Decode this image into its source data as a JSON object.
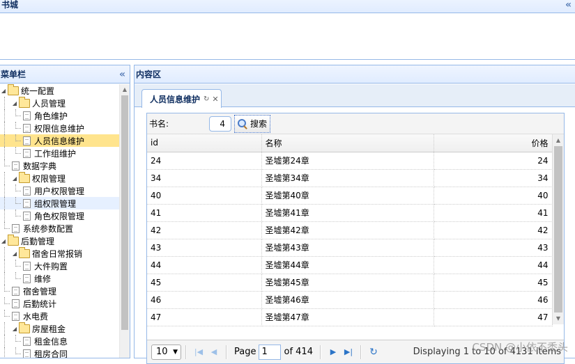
{
  "north": {
    "title": "书城",
    "collapse_icon": "double-chevron-up-icon"
  },
  "west": {
    "title": "菜单栏",
    "collapse_icon": "double-chevron-left-icon",
    "tree": [
      {
        "label": "统一配置",
        "level": 0,
        "type": "folder",
        "expanded": true
      },
      {
        "label": "人员管理",
        "level": 1,
        "type": "folder",
        "expanded": true
      },
      {
        "label": "角色维护",
        "level": 2,
        "type": "file"
      },
      {
        "label": "权限信息维护",
        "level": 2,
        "type": "file"
      },
      {
        "label": "人员信息维护",
        "level": 2,
        "type": "file",
        "selected": true
      },
      {
        "label": "工作组维护",
        "level": 2,
        "type": "file"
      },
      {
        "label": "数据字典",
        "level": 1,
        "type": "file"
      },
      {
        "label": "权限管理",
        "level": 1,
        "type": "folder",
        "expanded": true
      },
      {
        "label": "用户权限管理",
        "level": 2,
        "type": "file"
      },
      {
        "label": "组权限管理",
        "level": 2,
        "type": "file",
        "hover": true
      },
      {
        "label": "角色权限管理",
        "level": 2,
        "type": "file"
      },
      {
        "label": "系统参数配置",
        "level": 1,
        "type": "file"
      },
      {
        "label": "后勤管理",
        "level": 0,
        "type": "folder",
        "expanded": true
      },
      {
        "label": "宿舍日常报销",
        "level": 1,
        "type": "folder",
        "expanded": true
      },
      {
        "label": "大件购置",
        "level": 2,
        "type": "file"
      },
      {
        "label": "维修",
        "level": 2,
        "type": "file"
      },
      {
        "label": "宿舍管理",
        "level": 1,
        "type": "file"
      },
      {
        "label": "后勤统计",
        "level": 1,
        "type": "file"
      },
      {
        "label": "水电费",
        "level": 1,
        "type": "file"
      },
      {
        "label": "房屋租金",
        "level": 1,
        "type": "folder",
        "expanded": true
      },
      {
        "label": "租金信息",
        "level": 2,
        "type": "file"
      },
      {
        "label": "租房合同",
        "level": 2,
        "type": "file"
      }
    ]
  },
  "center": {
    "title": "内容区",
    "tab": {
      "label": "人员信息维护",
      "refresh_icon": "refresh-icon",
      "close_icon": "close-icon"
    },
    "toolbar": {
      "label": "书名:",
      "input_value": "4",
      "search_label": "搜索"
    },
    "columns": [
      "id",
      "名称",
      "价格"
    ],
    "rows": [
      [
        "24",
        "圣墟第24章",
        "24"
      ],
      [
        "34",
        "圣墟第34章",
        "34"
      ],
      [
        "40",
        "圣墟第40章",
        "40"
      ],
      [
        "41",
        "圣墟第41章",
        "41"
      ],
      [
        "42",
        "圣墟第42章",
        "42"
      ],
      [
        "43",
        "圣墟第43章",
        "43"
      ],
      [
        "44",
        "圣墟第44章",
        "44"
      ],
      [
        "45",
        "圣墟第45章",
        "45"
      ],
      [
        "46",
        "圣墟第46章",
        "46"
      ],
      [
        "47",
        "圣墟第47章",
        "47"
      ]
    ],
    "pager": {
      "page_size": "10",
      "page_label": "Page",
      "page_value": "1",
      "of_label": "of 414",
      "info": "Displaying 1 to 10 of 4131 items"
    }
  },
  "watermark": "CSDN @小依不秃头"
}
